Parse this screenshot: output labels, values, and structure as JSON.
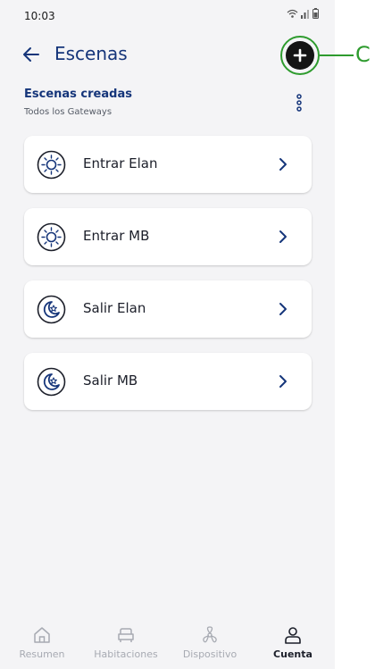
{
  "status_bar": {
    "time": "10:03"
  },
  "header": {
    "title": "Escenas"
  },
  "annotation": {
    "label": "C"
  },
  "section": {
    "title": "Escenas creadas",
    "subtitle": "Todos los Gateways"
  },
  "scenes": [
    {
      "label": "Entrar Elan",
      "icon": "sun-icon"
    },
    {
      "label": "Entrar MB",
      "icon": "sun-icon"
    },
    {
      "label": "Salir Elan",
      "icon": "moon-icon"
    },
    {
      "label": "Salir MB",
      "icon": "moon-icon"
    }
  ],
  "bottom_nav": {
    "items": [
      {
        "label": "Resumen",
        "icon": "home-icon",
        "active": false
      },
      {
        "label": "Habitaciones",
        "icon": "sofa-icon",
        "active": false
      },
      {
        "label": "Dispositivo",
        "icon": "fan-icon",
        "active": false
      },
      {
        "label": "Cuenta",
        "icon": "user-icon",
        "active": true
      }
    ]
  },
  "colors": {
    "primary": "#15357a",
    "annotation": "#2e9b2e",
    "background": "#f4f4f6"
  }
}
